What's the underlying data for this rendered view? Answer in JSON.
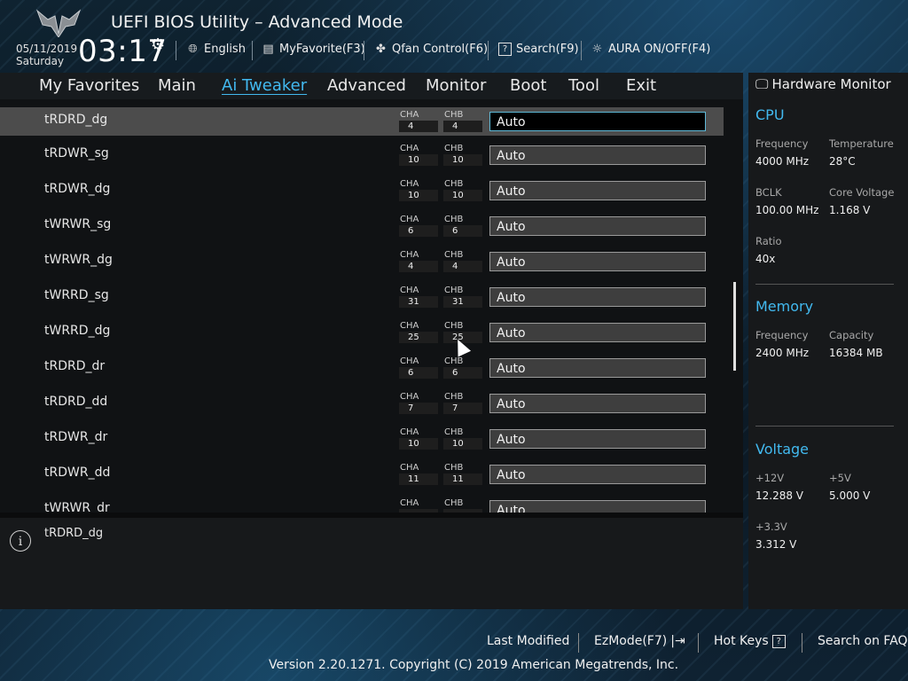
{
  "header": {
    "title": "UEFI BIOS Utility – Advanced Mode",
    "date": "05/11/2019",
    "day": "Saturday",
    "time": "03:17",
    "toolbar": [
      {
        "label": "English",
        "icon": "globe-icon"
      },
      {
        "label": "MyFavorite(F3)",
        "icon": "favorite-icon"
      },
      {
        "label": "Qfan Control(F6)",
        "icon": "fan-icon"
      },
      {
        "label": "Search(F9)",
        "icon": "search-icon"
      },
      {
        "label": "AURA ON/OFF(F4)",
        "icon": "aura-icon"
      }
    ]
  },
  "menu": {
    "items": [
      "My Favorites",
      "Main",
      "Ai Tweaker",
      "Advanced",
      "Monitor",
      "Boot",
      "Tool",
      "Exit"
    ],
    "active": "Ai Tweaker"
  },
  "rows": [
    {
      "label": "tRDRD_dg",
      "cha": "4",
      "chb": "4",
      "value": "Auto"
    },
    {
      "label": "tRDWR_sg",
      "cha": "10",
      "chb": "10",
      "value": "Auto"
    },
    {
      "label": "tRDWR_dg",
      "cha": "10",
      "chb": "10",
      "value": "Auto"
    },
    {
      "label": "tWRWR_sg",
      "cha": "6",
      "chb": "6",
      "value": "Auto"
    },
    {
      "label": "tWRWR_dg",
      "cha": "4",
      "chb": "4",
      "value": "Auto"
    },
    {
      "label": "tWRRD_sg",
      "cha": "31",
      "chb": "31",
      "value": "Auto"
    },
    {
      "label": "tWRRD_dg",
      "cha": "25",
      "chb": "25",
      "value": "Auto"
    },
    {
      "label": "tRDRD_dr",
      "cha": "6",
      "chb": "6",
      "value": "Auto"
    },
    {
      "label": "tRDRD_dd",
      "cha": "7",
      "chb": "7",
      "value": "Auto"
    },
    {
      "label": "tRDWR_dr",
      "cha": "10",
      "chb": "10",
      "value": "Auto"
    },
    {
      "label": "tRDWR_dd",
      "cha": "11",
      "chb": "11",
      "value": "Auto"
    },
    {
      "label": "tWRWR_dr",
      "cha": "",
      "chb": "",
      "value": "Auto"
    }
  ],
  "channel_labels": {
    "a": "CHA",
    "b": "CHB"
  },
  "help": {
    "text": "tRDRD_dg"
  },
  "hw_monitor": {
    "title": "Hardware Monitor",
    "cpu": {
      "heading": "CPU",
      "frequency_label": "Frequency",
      "frequency": "4000 MHz",
      "temperature_label": "Temperature",
      "temperature": "28°C",
      "bclk_label": "BCLK",
      "bclk": "100.00 MHz",
      "core_voltage_label": "Core Voltage",
      "core_voltage": "1.168 V",
      "ratio_label": "Ratio",
      "ratio": "40x"
    },
    "memory": {
      "heading": "Memory",
      "frequency_label": "Frequency",
      "frequency": "2400 MHz",
      "capacity_label": "Capacity",
      "capacity": "16384 MB"
    },
    "voltage": {
      "heading": "Voltage",
      "v12_label": "+12V",
      "v12": "12.288 V",
      "v5_label": "+5V",
      "v5": "5.000 V",
      "v33_label": "+3.3V",
      "v33": "3.312 V"
    }
  },
  "footer": {
    "last_modified": "Last Modified",
    "ezmode": "EzMode(F7)",
    "hot_keys": "Hot Keys",
    "search_faq": "Search on FAQ",
    "copyright": "Version 2.20.1271. Copyright (C) 2019 American Megatrends, Inc."
  }
}
